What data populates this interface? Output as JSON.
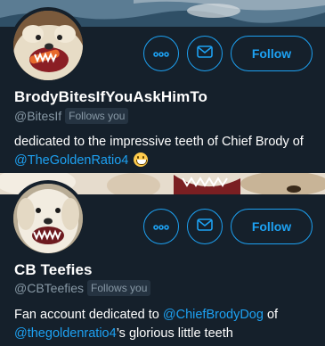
{
  "users": [
    {
      "display_name": "BrodyBitesIfYouAskHimTo",
      "handle": "@BitesIf",
      "follows_badge": "Follows you",
      "bio_text": "dedicated to the impressive teeth of Chief Brody of ",
      "bio_link": "@TheGoldenRatio4",
      "bio_emoji": "grinning-face-emoji",
      "follow_label": "Follow"
    },
    {
      "display_name": "CB Teefies",
      "handle": "@CBTeefies",
      "follows_badge": "Follows you",
      "bio_text_1": "Fan account dedicated to ",
      "bio_link_1": "@ChiefBrodyDog",
      "bio_text_2": " of ",
      "bio_link_2": "@thegoldenratio4",
      "bio_text_3": "’s glorious little teeth",
      "follow_label": "Follow"
    }
  ],
  "icons": {
    "more": "more-icon",
    "message": "envelope-icon"
  },
  "colors": {
    "background": "#15202b",
    "accent": "#1da1f2",
    "secondary_text": "#8899a6"
  }
}
